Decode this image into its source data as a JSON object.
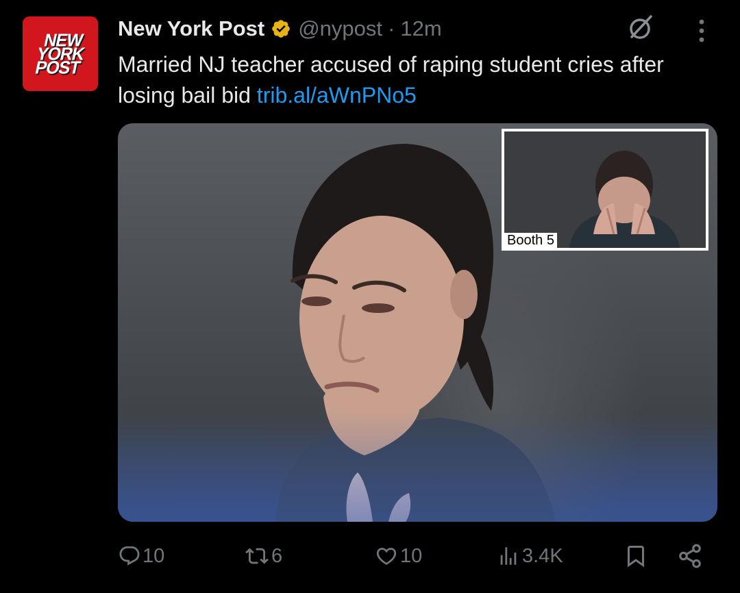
{
  "author": {
    "display_name": "New York Post",
    "handle": "@nypost",
    "separator": "·",
    "time": "12m",
    "avatar_logo_lines": [
      "NEW",
      "YORK",
      "POST"
    ],
    "verified_color": "#e7b416",
    "avatar_color": "#d2161e"
  },
  "tweet": {
    "text": "Married NJ teacher accused of raping student cries after losing bail bid",
    "link_text": "trib.al/aWnPNo5",
    "link_color": "#1d9bf0"
  },
  "media": {
    "inset_label": "Booth 5"
  },
  "actions": {
    "replies": "10",
    "reposts": "6",
    "likes": "10",
    "views": "3.4K"
  },
  "icons": {
    "grok": "grok-icon",
    "more": "more-icon",
    "reply": "reply-icon",
    "repost": "repost-icon",
    "like": "like-icon",
    "views": "views-icon",
    "bookmark": "bookmark-icon",
    "share": "share-icon"
  }
}
